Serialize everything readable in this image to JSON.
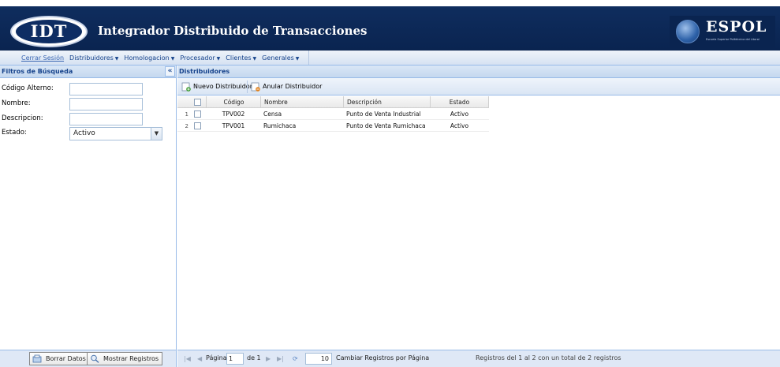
{
  "header": {
    "logo_text": "IDT",
    "title": "Integrador Distribuido de Transacciones",
    "brand": "ESPOL",
    "brand_sub": "Escuela Superior Politécnica del Litoral"
  },
  "menu": {
    "logout": "Cerrar Sesión",
    "items": [
      "Distribuidores",
      "Homologacion",
      "Procesador",
      "Clientes",
      "Generales"
    ]
  },
  "filters": {
    "title": "Filtros de Búsqueda",
    "fields": [
      {
        "label": "Código Alterno:",
        "value": ""
      },
      {
        "label": "Nombre:",
        "value": ""
      },
      {
        "label": "Descripcion:",
        "value": ""
      }
    ],
    "estado_label": "Estado:",
    "estado_value": "Activo",
    "clear_button": "Borrar Datos",
    "show_button": "Mostrar Registros"
  },
  "grid": {
    "title": "Distribuidores",
    "new_button": "Nuevo Distribuidor",
    "cancel_button": "Anular Distribuidor",
    "columns": [
      "Código",
      "Nombre",
      "Descripción",
      "Estado"
    ],
    "rows": [
      {
        "num": "1",
        "codigo": "TPV002",
        "nombre": "Censa",
        "descripcion": "Punto de Venta Industrial",
        "estado": "Activo"
      },
      {
        "num": "2",
        "codigo": "TPV001",
        "nombre": "Rumichaca",
        "descripcion": "Punto de Venta Rumichaca",
        "estado": "Activo"
      }
    ]
  },
  "pager": {
    "page_label": "Página",
    "page_value": "1",
    "of_label": "de 1",
    "page_size": "10",
    "page_size_label": "Cambiar Registros por Página",
    "summary": "Registros del 1 al 2 con un total de 2 registros"
  },
  "colors": {
    "header_bg": "#0a2450",
    "panel_header": "#c4d8ef",
    "panel_text": "#15428b"
  }
}
